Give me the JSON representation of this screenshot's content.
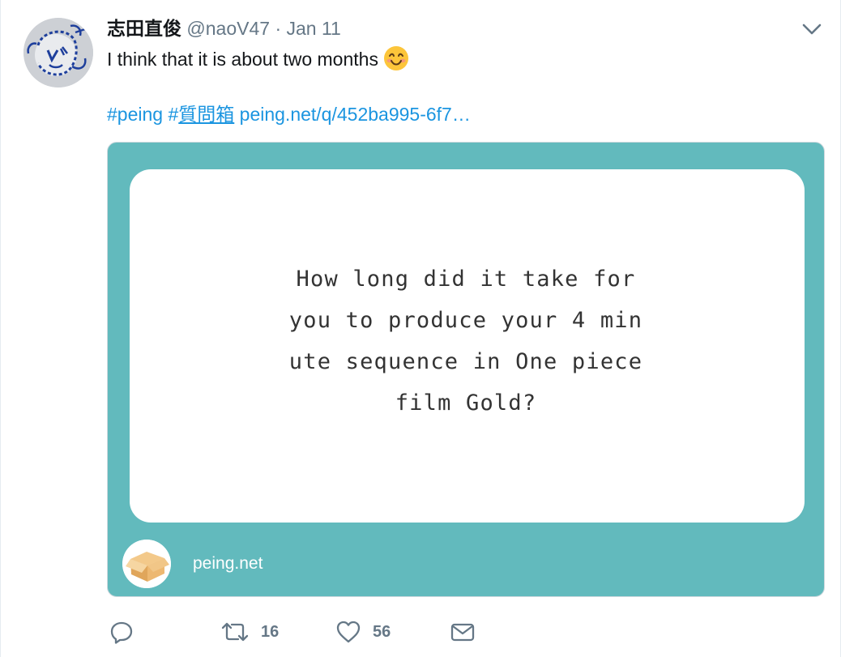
{
  "tweet": {
    "author": {
      "display_name": "志田直俊",
      "handle": "@naoV47",
      "separator": "·",
      "timestamp": "Jan 11",
      "avatar_icon": "avatar-doodle-icon"
    },
    "text": "I think that it is about two months",
    "emoji": "smiling-face-icon",
    "hashtag_1": "#peing",
    "hashtag_2_prefix": "#",
    "hashtag_2_text": "質問箱",
    "link": "peing.net/q/452ba995-6f7…",
    "menu_icon": "chevron-down-icon"
  },
  "card": {
    "question": "How long did it take for you to produce your 4 minute sequence in One piece film Gold?",
    "site": "peing.net",
    "site_icon": "box-icon",
    "colors": {
      "background": "#62babd",
      "question_box": "#ffffff"
    }
  },
  "actions": {
    "reply_icon": "reply-icon",
    "retweet_icon": "retweet-icon",
    "retweet_count": "16",
    "like_icon": "heart-icon",
    "like_count": "56",
    "dm_icon": "envelope-icon"
  },
  "colors": {
    "link": "#1b95e0",
    "secondary_text": "#657786",
    "icon": "#657786"
  }
}
